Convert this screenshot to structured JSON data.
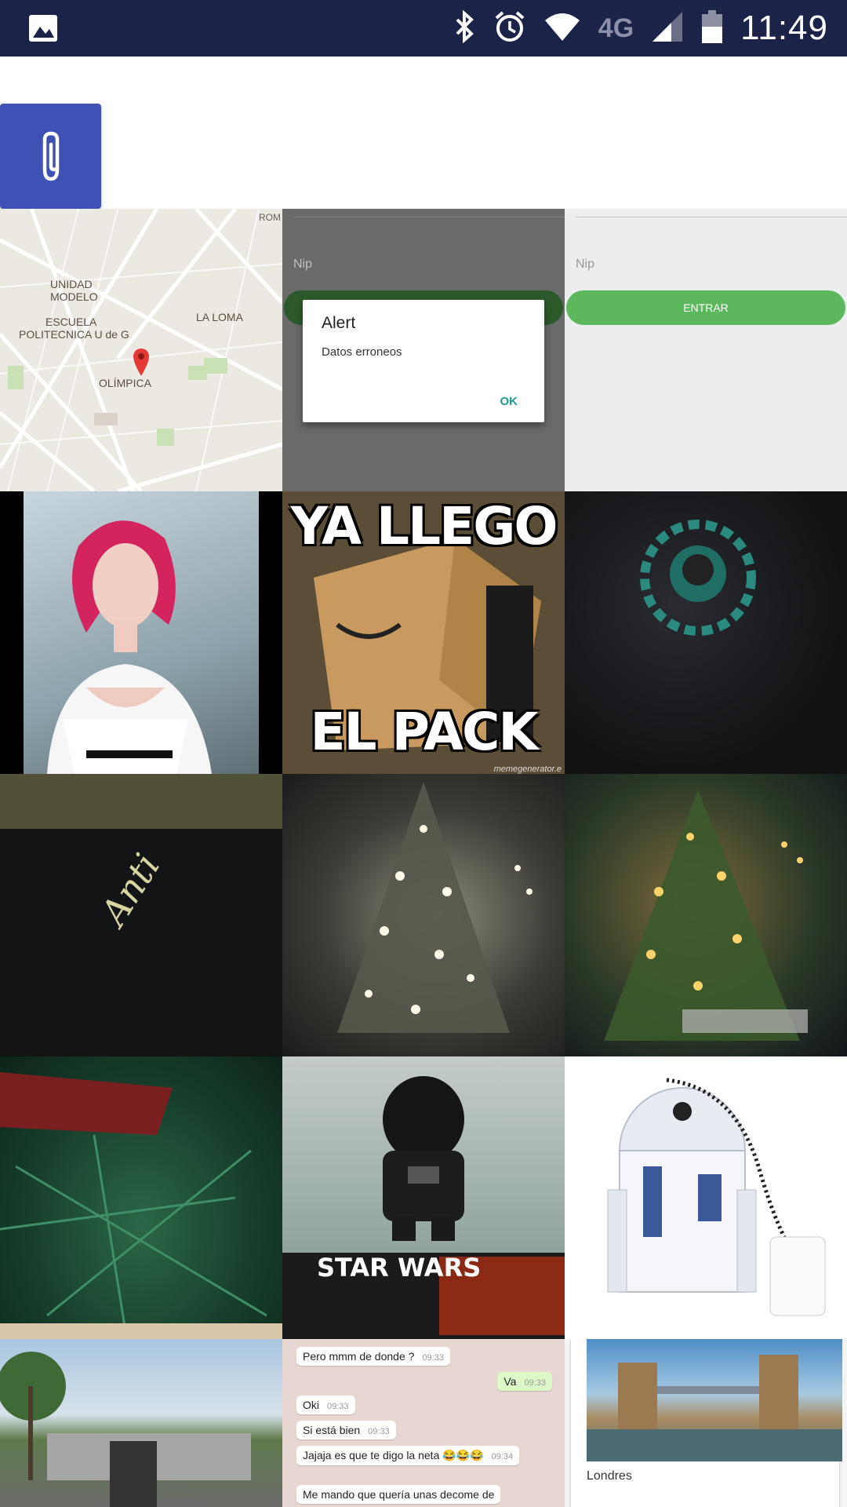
{
  "statusbar": {
    "network": "4G",
    "time": "11:49"
  },
  "map": {
    "labels": [
      "UNIDAD",
      "MODELO",
      "ESCUELA",
      "POLITECNICA U de G",
      "LA LOMA",
      "OLÍMPICA",
      "ROM"
    ]
  },
  "login_dim": {
    "nip_label": "Nip",
    "alert_title": "Alert",
    "alert_message": "Datos erroneos",
    "alert_ok": "OK"
  },
  "login_light": {
    "nip_label": "Nip",
    "button_label": "ENTRAR"
  },
  "meme": {
    "top_text": "YA LLEGO",
    "bottom_text": "EL PACK",
    "footer": "memegenerator.e"
  },
  "anti_text": "Anti",
  "vader_logo": "STAR WARS",
  "chat": {
    "messages": [
      {
        "text": "Pero mmm de donde ?",
        "time": "09:33"
      },
      {
        "text": "Va",
        "time": "09:33"
      },
      {
        "text": "Oki",
        "time": "09:33"
      },
      {
        "text": "Si está bien",
        "time": "09:33"
      },
      {
        "text": "Jajaja es que te digo la neta 😂😂😂",
        "time": "09:34"
      },
      {
        "text": "Me mando que quería unas decome de",
        "time": ""
      }
    ]
  },
  "london": {
    "label": "Londres"
  },
  "colors": {
    "statusbar": "#1c2349",
    "accent": "#3f51b5",
    "button_green": "#5cb85c",
    "ok_teal": "#1e9a8a"
  },
  "icons": [
    "image-icon",
    "bluetooth-icon",
    "alarm-icon",
    "wifi-icon",
    "signal-icon",
    "battery-icon",
    "paperclip-icon"
  ]
}
